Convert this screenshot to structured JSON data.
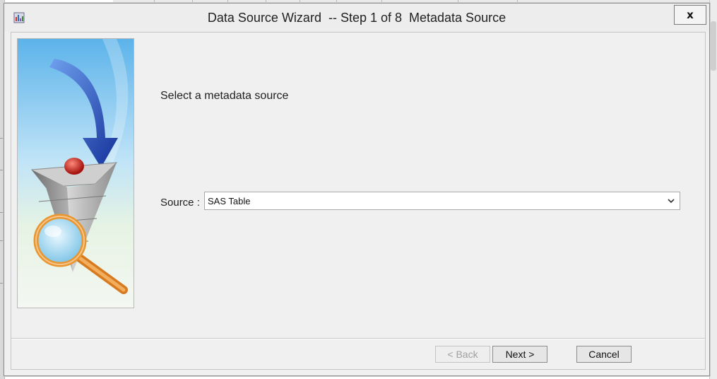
{
  "dialog": {
    "title": "Data Source Wizard  -- Step 1 of 8  Metadata Source",
    "close_label": "x"
  },
  "main": {
    "heading": "Select a metadata source",
    "source_label": "Source :",
    "source_value": "SAS Table"
  },
  "footer": {
    "back_label": "< Back",
    "next_label": "Next >",
    "cancel_label": "Cancel"
  },
  "icons": {
    "app": "wizard-app-icon",
    "close": "close-icon",
    "dropdown": "chevron-down-icon",
    "illustration": "funnel-magnifier-illustration"
  },
  "colors": {
    "arrow_blue": "#1f4fb8",
    "funnel_gray": "#9a9a9a",
    "magnifier_orange": "#e8962f",
    "sky_blue": "#7fc3ee"
  }
}
